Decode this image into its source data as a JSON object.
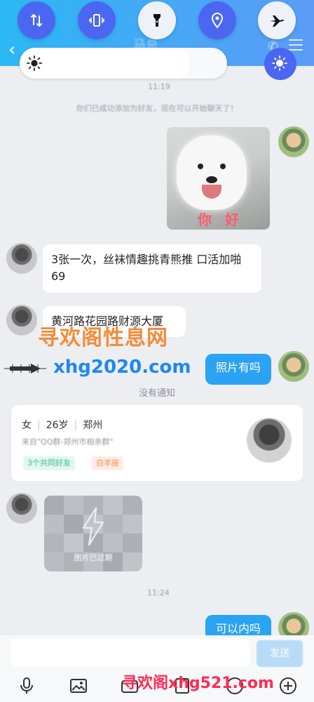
{
  "header": {
    "title": "马总",
    "subtitle": "",
    "back_icon": "chevron-left-icon",
    "phone_icon": "phone-icon",
    "menu_icon": "menu-icon"
  },
  "quick_settings": {
    "buttons": [
      {
        "name": "mobile-data",
        "icon": "data-arrows-icon",
        "active": true
      },
      {
        "name": "vibrate",
        "icon": "vibrate-icon",
        "active": true
      },
      {
        "name": "flashlight",
        "icon": "flashlight-icon",
        "active": false
      },
      {
        "name": "location",
        "icon": "location-icon",
        "active": true
      },
      {
        "name": "airplane",
        "icon": "airplane-icon",
        "active": false
      }
    ],
    "brightness_level": 0.82,
    "accent": "#4b67f2"
  },
  "chat": {
    "time1": "11:19",
    "system_text": "你们已成功添加为好友，现在可以开始聊天了！",
    "sticker_caption": "你 好",
    "msg1": "3张一次，丝袜情趣挑青熊推 口活加啪 69",
    "msg2": "黄河路花园路财源大厦",
    "msg3": "照片有吗",
    "notice": "没有通知",
    "card": {
      "gender": "女",
      "age": "26岁",
      "city": "郑州",
      "source": "来自\"QQ群-郑州市相亲群\"",
      "tag1": "3个共同好友",
      "tag2": "白羊座"
    },
    "image_status": "图片已过期",
    "time2": "11:24",
    "msg4": "可以内吗"
  },
  "watermarks": {
    "line1": "寻欢阁性息网",
    "line2": "xhg2020.com",
    "line3": "寻欢阁xhg521.com"
  },
  "input": {
    "send_label": "发送",
    "placeholder": ""
  },
  "colors": {
    "header": "#2bb8f5",
    "bubble_out": "#2aa3f4"
  }
}
